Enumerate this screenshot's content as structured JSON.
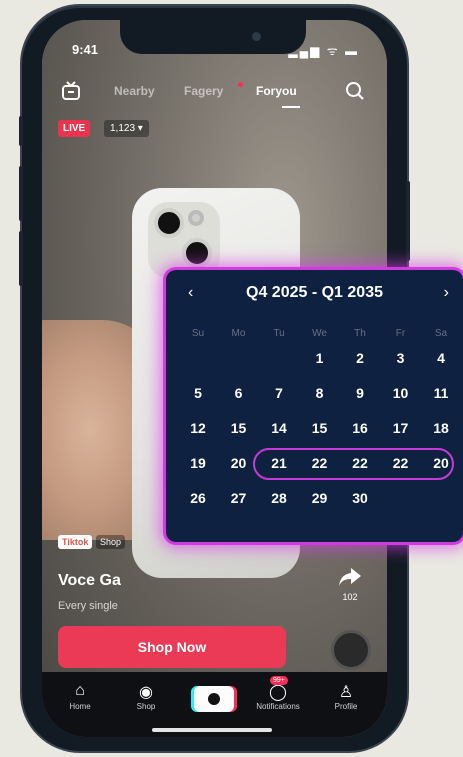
{
  "status": {
    "time": "9:41",
    "icons": "▂▄▆ ᯤ ▬"
  },
  "topnav": {
    "tabs": [
      {
        "label": "Nearby",
        "active": false
      },
      {
        "label": "Fagery",
        "active": false
      },
      {
        "label": "Foryou",
        "active": true
      }
    ]
  },
  "live": {
    "badge": "LIVE",
    "viewers": "1,123 ▾"
  },
  "calendar": {
    "title": "Q4 2025 - Q1 2035",
    "prev": "‹",
    "next": "›",
    "day_names": [
      "Su",
      "Mo",
      "Tu",
      "We",
      "Th",
      "Fr",
      "Sa"
    ],
    "rows": [
      [
        "",
        "",
        "",
        "1",
        "2",
        "3",
        "4"
      ],
      [
        "5",
        "6",
        "7",
        "8",
        "9",
        "10",
        "11"
      ],
      [
        "12",
        "15",
        "14",
        "15",
        "16",
        "17",
        "18"
      ],
      [
        "19",
        "20",
        "21",
        "22",
        "22",
        "22",
        "20"
      ],
      [
        "26",
        "27",
        "28",
        "29",
        "30",
        "",
        ""
      ]
    ],
    "selected_range_row": 3,
    "accent_color": "#d03be0",
    "bg_color": "#0f2140"
  },
  "product": {
    "tag": "Tiktok",
    "tag2": "Shop",
    "title": "Voce Ga",
    "subtitle": "Every single",
    "cta": "Shop Now"
  },
  "side": {
    "share_icon": "share-icon",
    "share_count": "102"
  },
  "bottomnav": {
    "items": [
      {
        "icon": "⌂",
        "label": "Home"
      },
      {
        "icon": "◉",
        "label": "Shop"
      },
      {
        "icon": "",
        "label": ""
      },
      {
        "icon": "◯",
        "label": "Notifications",
        "badge": "99+"
      },
      {
        "icon": "♙",
        "label": "Profile"
      }
    ]
  }
}
